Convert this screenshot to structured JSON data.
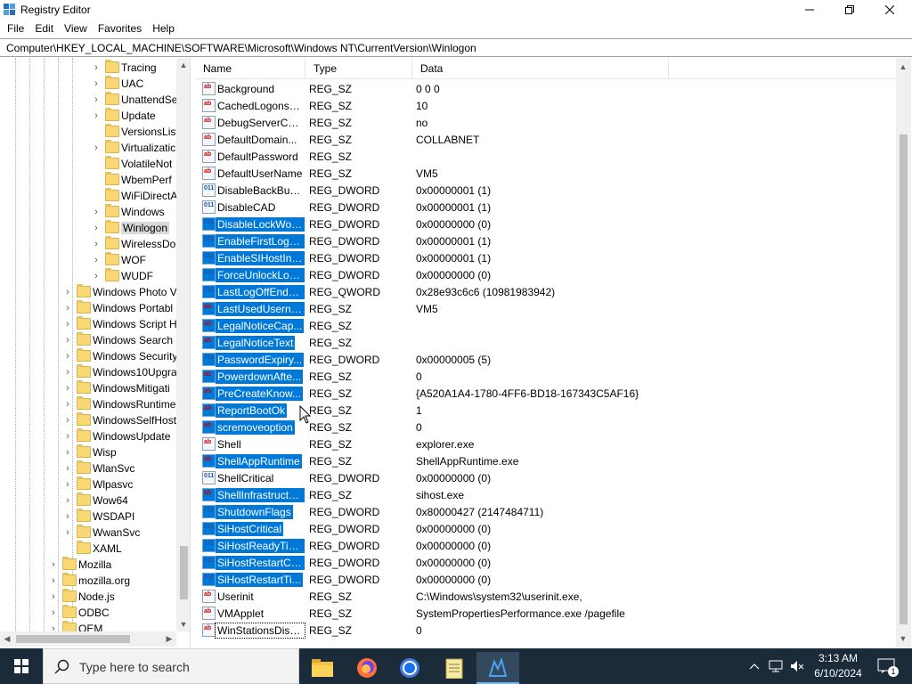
{
  "window": {
    "title": "Registry Editor"
  },
  "menu": [
    "File",
    "Edit",
    "View",
    "Favorites",
    "Help"
  ],
  "address": "Computer\\HKEY_LOCAL_MACHINE\\SOFTWARE\\Microsoft\\Windows NT\\CurrentVersion\\Winlogon",
  "tree": {
    "items": [
      {
        "label": "Tracing",
        "level": 2,
        "chevron": true
      },
      {
        "label": "UAC",
        "level": 2,
        "chevron": true
      },
      {
        "label": "UnattendSe",
        "level": 2,
        "chevron": true
      },
      {
        "label": "Update",
        "level": 2,
        "chevron": true
      },
      {
        "label": "VersionsList",
        "level": 2,
        "chevron": false
      },
      {
        "label": "Virtualizatic",
        "level": 2,
        "chevron": true
      },
      {
        "label": "VolatileNot",
        "level": 2,
        "chevron": false
      },
      {
        "label": "WbemPerf",
        "level": 2,
        "chevron": false
      },
      {
        "label": "WiFiDirectA",
        "level": 2,
        "chevron": false
      },
      {
        "label": "Windows",
        "level": 2,
        "chevron": true
      },
      {
        "label": "Winlogon",
        "level": 2,
        "chevron": true,
        "selected": true
      },
      {
        "label": "WirelessDo",
        "level": 2,
        "chevron": true
      },
      {
        "label": "WOF",
        "level": 2,
        "chevron": true
      },
      {
        "label": "WUDF",
        "level": 2,
        "chevron": true
      },
      {
        "label": "Windows Photo V",
        "level": 1,
        "chevron": true
      },
      {
        "label": "Windows Portabl",
        "level": 1,
        "chevron": true
      },
      {
        "label": "Windows Script H",
        "level": 1,
        "chevron": true
      },
      {
        "label": "Windows Search",
        "level": 1,
        "chevron": true
      },
      {
        "label": "Windows Security",
        "level": 1,
        "chevron": true
      },
      {
        "label": "Windows10Upgra",
        "level": 1,
        "chevron": true
      },
      {
        "label": "WindowsMitigati",
        "level": 1,
        "chevron": true
      },
      {
        "label": "WindowsRuntime",
        "level": 1,
        "chevron": true
      },
      {
        "label": "WindowsSelfHost",
        "level": 1,
        "chevron": true
      },
      {
        "label": "WindowsUpdate",
        "level": 1,
        "chevron": true
      },
      {
        "label": "Wisp",
        "level": 1,
        "chevron": true
      },
      {
        "label": "WlanSvc",
        "level": 1,
        "chevron": true
      },
      {
        "label": "Wlpasvc",
        "level": 1,
        "chevron": true
      },
      {
        "label": "Wow64",
        "level": 1,
        "chevron": true
      },
      {
        "label": "WSDAPI",
        "level": 1,
        "chevron": true
      },
      {
        "label": "WwanSvc",
        "level": 1,
        "chevron": true
      },
      {
        "label": "XAML",
        "level": 1,
        "chevron": false
      },
      {
        "label": "Mozilla",
        "level": 0,
        "chevron": true
      },
      {
        "label": "mozilla.org",
        "level": 0,
        "chevron": true
      },
      {
        "label": "Node.js",
        "level": 0,
        "chevron": true
      },
      {
        "label": "ODBC",
        "level": 0,
        "chevron": true
      },
      {
        "label": "OEM",
        "level": 0,
        "chevron": true
      }
    ]
  },
  "columns": {
    "name": "Name",
    "type": "Type",
    "data": "Data"
  },
  "values": [
    {
      "name": "Background",
      "type": "REG_SZ",
      "data": "0 0 0",
      "icon": "sz"
    },
    {
      "name": "CachedLogonsC...",
      "type": "REG_SZ",
      "data": "10",
      "icon": "sz"
    },
    {
      "name": "DebugServerCo...",
      "type": "REG_SZ",
      "data": "no",
      "icon": "sz"
    },
    {
      "name": "DefaultDomain...",
      "type": "REG_SZ",
      "data": "COLLABNET",
      "icon": "sz"
    },
    {
      "name": "DefaultPassword",
      "type": "REG_SZ",
      "data": "",
      "icon": "sz"
    },
    {
      "name": "DefaultUserName",
      "type": "REG_SZ",
      "data": "VM5",
      "icon": "sz"
    },
    {
      "name": "DisableBackButt...",
      "type": "REG_DWORD",
      "data": "0x00000001 (1)",
      "icon": "bin"
    },
    {
      "name": "DisableCAD",
      "type": "REG_DWORD",
      "data": "0x00000001 (1)",
      "icon": "bin"
    },
    {
      "name": "DisableLockWor...",
      "type": "REG_DWORD",
      "data": "0x00000000 (0)",
      "icon": "bin",
      "selected": true
    },
    {
      "name": "EnableFirstLogo...",
      "type": "REG_DWORD",
      "data": "0x00000001 (1)",
      "icon": "bin",
      "selected": true
    },
    {
      "name": "EnableSIHostInt...",
      "type": "REG_DWORD",
      "data": "0x00000001 (1)",
      "icon": "bin",
      "selected": true
    },
    {
      "name": "ForceUnlockLog...",
      "type": "REG_DWORD",
      "data": "0x00000000 (0)",
      "icon": "bin",
      "selected": true
    },
    {
      "name": "LastLogOffEndTi...",
      "type": "REG_QWORD",
      "data": "0x28e93c6c6 (10981983942)",
      "icon": "bin",
      "selected": true
    },
    {
      "name": "LastUsedUserna...",
      "type": "REG_SZ",
      "data": "VM5",
      "icon": "sz",
      "selected": true
    },
    {
      "name": "LegalNoticeCap...",
      "type": "REG_SZ",
      "data": "",
      "icon": "sz",
      "selected": true
    },
    {
      "name": "LegalNoticeText",
      "type": "REG_SZ",
      "data": "",
      "icon": "sz",
      "selected": true
    },
    {
      "name": "PasswordExpiry...",
      "type": "REG_DWORD",
      "data": "0x00000005 (5)",
      "icon": "bin",
      "selected": true
    },
    {
      "name": "PowerdownAfte...",
      "type": "REG_SZ",
      "data": "0",
      "icon": "sz",
      "selected": true
    },
    {
      "name": "PreCreateKnow...",
      "type": "REG_SZ",
      "data": "{A520A1A4-1780-4FF6-BD18-167343C5AF16}",
      "icon": "sz",
      "selected": true
    },
    {
      "name": "ReportBootOk",
      "type": "REG_SZ",
      "data": "1",
      "icon": "sz",
      "selected": true
    },
    {
      "name": "scremoveoption",
      "type": "REG_SZ",
      "data": "0",
      "icon": "sz",
      "selected": true
    },
    {
      "name": "Shell",
      "type": "REG_SZ",
      "data": "explorer.exe",
      "icon": "sz"
    },
    {
      "name": "ShellAppRuntime",
      "type": "REG_SZ",
      "data": "ShellAppRuntime.exe",
      "icon": "sz",
      "selected": true
    },
    {
      "name": "ShellCritical",
      "type": "REG_DWORD",
      "data": "0x00000000 (0)",
      "icon": "bin"
    },
    {
      "name": "ShellInfrastructure",
      "type": "REG_SZ",
      "data": "sihost.exe",
      "icon": "sz",
      "selected": true
    },
    {
      "name": "ShutdownFlags",
      "type": "REG_DWORD",
      "data": "0x80000427 (2147484711)",
      "icon": "bin",
      "selected": true
    },
    {
      "name": "SiHostCritical",
      "type": "REG_DWORD",
      "data": "0x00000000 (0)",
      "icon": "bin",
      "selected": true
    },
    {
      "name": "SiHostReadyTim...",
      "type": "REG_DWORD",
      "data": "0x00000000 (0)",
      "icon": "bin",
      "selected": true
    },
    {
      "name": "SiHostRestartCo...",
      "type": "REG_DWORD",
      "data": "0x00000000 (0)",
      "icon": "bin",
      "selected": true
    },
    {
      "name": "SiHostRestartTi...",
      "type": "REG_DWORD",
      "data": "0x00000000 (0)",
      "icon": "bin",
      "selected": true
    },
    {
      "name": "Userinit",
      "type": "REG_SZ",
      "data": "C:\\Windows\\system32\\userinit.exe,",
      "icon": "sz"
    },
    {
      "name": "VMApplet",
      "type": "REG_SZ",
      "data": "SystemPropertiesPerformance.exe /pagefile",
      "icon": "sz"
    },
    {
      "name": "WinStationsDisa...",
      "type": "REG_SZ",
      "data": "0",
      "icon": "sz",
      "focus": true
    }
  ],
  "taskbar": {
    "search_placeholder": "Type here to search",
    "time": "3:13 AM",
    "date": "6/10/2024",
    "notification_count": "1"
  },
  "colors": {
    "selection": "#0078d7",
    "taskbar": "#1c2b3a"
  }
}
